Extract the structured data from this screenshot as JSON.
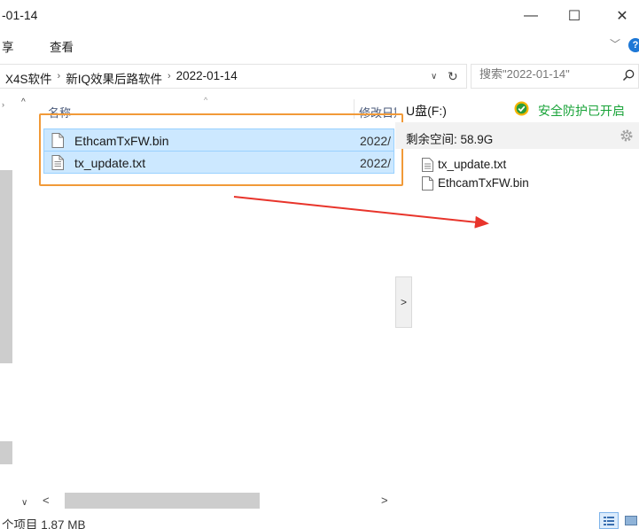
{
  "window": {
    "title": "-01-14",
    "minimize_glyph": "—",
    "maximize_glyph": "☐",
    "close_glyph": "✕"
  },
  "ribbon": {
    "tabs": [
      {
        "label": "享"
      },
      {
        "label": "查看"
      }
    ],
    "expand_glyph": "﹀",
    "help_glyph": "?"
  },
  "address": {
    "crumbs": [
      "X4S软件",
      "新IQ效果后路软件",
      "2022-01-14"
    ],
    "separator": "›",
    "dropdown_glyph": "∨",
    "refresh_glyph": "↻"
  },
  "search": {
    "placeholder": "搜索\"2022-01-14\""
  },
  "columns": {
    "name": "名称",
    "date": "修改日期",
    "sort_glyph": "^"
  },
  "files": [
    {
      "name": "EthcamTxFW.bin",
      "date": "2022/",
      "type": "generic-file"
    },
    {
      "name": "tx_update.txt",
      "date": "2022/",
      "type": "text-file"
    }
  ],
  "nav": {
    "up_glyph": "^",
    "down_glyph": "∨",
    "expand_glyph": "›"
  },
  "hscroll": {
    "left_glyph": "<",
    "right_glyph": ">"
  },
  "collapse_glyph": ">",
  "usb_panel": {
    "title": "U盘(F:)",
    "protection": "安全防护已开启",
    "free_space": "剩余空间: 58.9G",
    "files": [
      {
        "name": "tx_update.txt",
        "type": "text-file"
      },
      {
        "name": "EthcamTxFW.bin",
        "type": "generic-file"
      }
    ]
  },
  "status": {
    "text": "个项目 1.87 MB"
  },
  "colors": {
    "selection_bg": "#cce8ff",
    "selection_border": "#99d1ff",
    "highlight_box": "#f19a38",
    "arrow": "#e8342b",
    "protect_green": "#18a338",
    "help_blue": "#1e78d6"
  },
  "icons": {
    "search": "search-icon",
    "shield": "shield-icon",
    "gear": "gear-icon",
    "file": "file-icon",
    "text_file": "text-file-icon"
  }
}
